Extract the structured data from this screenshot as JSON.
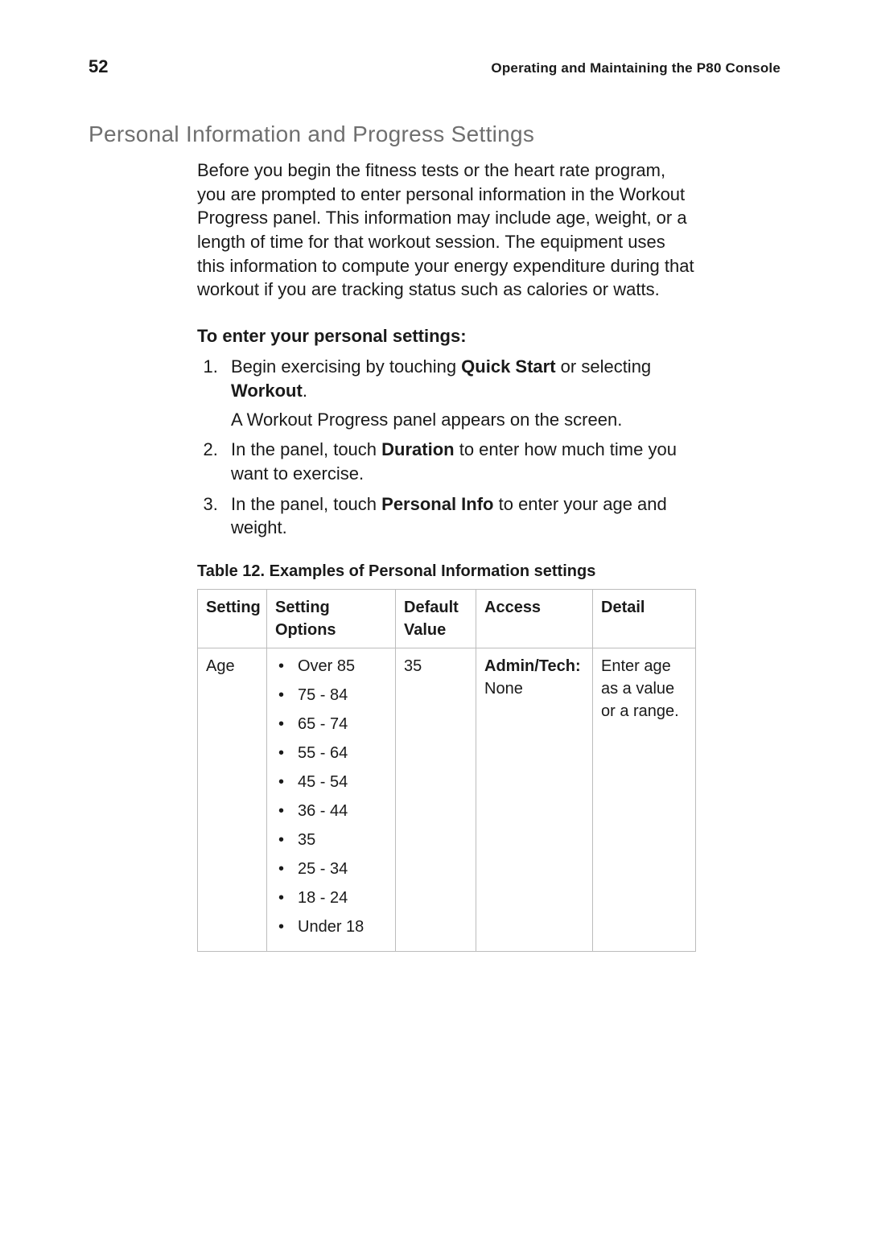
{
  "header": {
    "page_number": "52",
    "running_title": "Operating and Maintaining the P80 Console"
  },
  "section": {
    "title": "Personal Information and Progress Settings",
    "intro": "Before you begin the fitness tests or the heart rate program, you are prompted to enter personal information in the Workout Progress panel. This information may include age, weight, or a length of time for that workout session. The equipment uses this information to compute your energy expenditure during that workout if you are tracking status such as calories or watts.",
    "subhead": "To enter your personal settings:",
    "steps": {
      "s1_pre": "Begin exercising by touching ",
      "s1_b1": "Quick Start",
      "s1_mid": " or selecting ",
      "s1_b2": "Workout",
      "s1_post": ".",
      "s1_sub": "A Workout Progress panel appears on the screen.",
      "s2_pre": "In the panel, touch ",
      "s2_b1": "Duration",
      "s2_post": " to enter how much time you want to exercise.",
      "s3_pre": "In the panel, touch ",
      "s3_b1": "Personal Info",
      "s3_post": " to enter your age and weight."
    }
  },
  "table": {
    "caption_prefix": "Table  12.  ",
    "caption_title": "Examples of Personal Information settings",
    "columns": {
      "c1": "Setting",
      "c2": "Setting Options",
      "c3": "Default Value",
      "c4": "Access",
      "c5": "Detail"
    },
    "row1": {
      "setting": "Age",
      "options": {
        "o0": "Over 85",
        "o1": "75 - 84",
        "o2": "65 - 74",
        "o3": "55 - 64",
        "o4": "45 - 54",
        "o5": "36 - 44",
        "o6": "35",
        "o7": "25 - 34",
        "o8": "18 - 24",
        "o9": "Under 18"
      },
      "default_value": "35",
      "access_label": "Admin/Tech:",
      "access_value": " None",
      "detail": "Enter age as a value or a range."
    }
  }
}
